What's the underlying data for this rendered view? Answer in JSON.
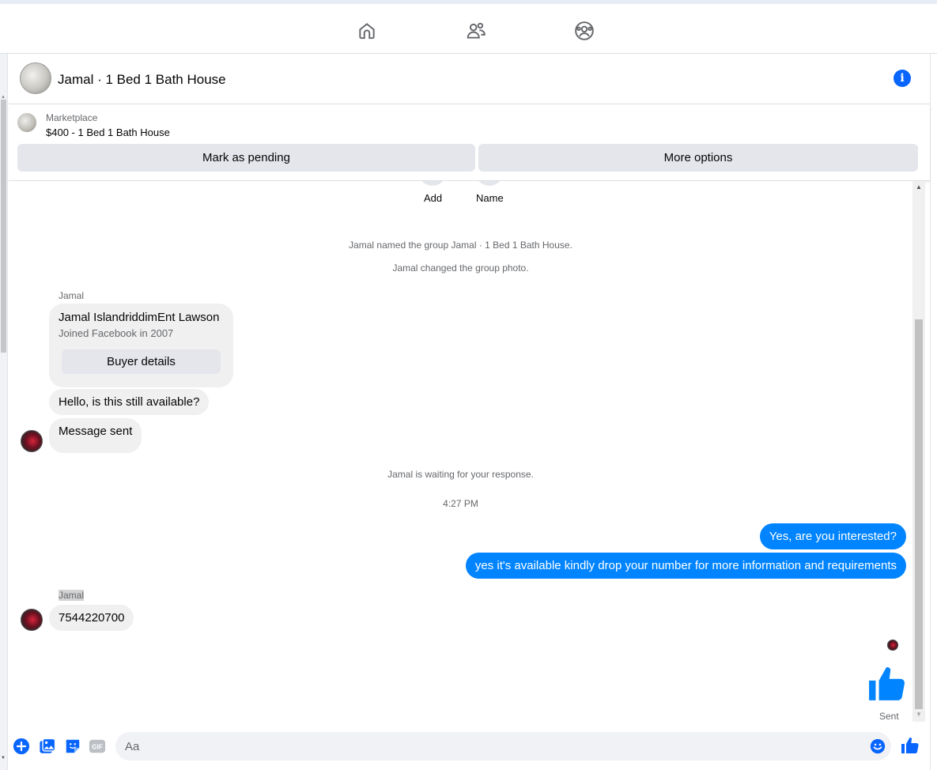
{
  "nav": {
    "home_icon": "home-icon",
    "friends_icon": "friends-icon",
    "groups_icon": "groups-icon"
  },
  "header": {
    "title": "Jamal · 1 Bed 1 Bath House",
    "info_icon": "info-icon"
  },
  "marketplace": {
    "label": "Marketplace",
    "listing": "$400 - 1 Bed 1 Bath House",
    "mark_pending": "Mark as pending",
    "more_options": "More options"
  },
  "thread": {
    "actions": [
      "Add",
      "Name"
    ],
    "system_events": [
      "Jamal named the group Jamal · 1 Bed 1 Bath House.",
      "Jamal changed the group photo."
    ],
    "sender_1": "Jamal",
    "buyer_card": {
      "name": "Jamal IslandriddimEnt Lawson",
      "joined": "Joined Facebook in 2007",
      "button": "Buyer details"
    },
    "incoming_1": "Hello, is this still available?",
    "incoming_2": "Message sent",
    "waiting": "Jamal is waiting for your response.",
    "timestamp": "4:27 PM",
    "outgoing_1": "Yes, are you interested?",
    "outgoing_2": "yes it's available kindly drop your number for more information and requirements",
    "sender_2": "Jamal",
    "incoming_3": "7544220700",
    "status": "Sent"
  },
  "composer": {
    "placeholder": "Aa",
    "icons": [
      "plus-icon",
      "photo-icon",
      "sticker-icon",
      "gif-icon",
      "emoji-icon",
      "like-icon"
    ],
    "gif_label": "GIF"
  },
  "colors": {
    "accent": "#0084ff",
    "brand_blue": "#0866ff",
    "bubble_gray": "#f0f0f0"
  }
}
